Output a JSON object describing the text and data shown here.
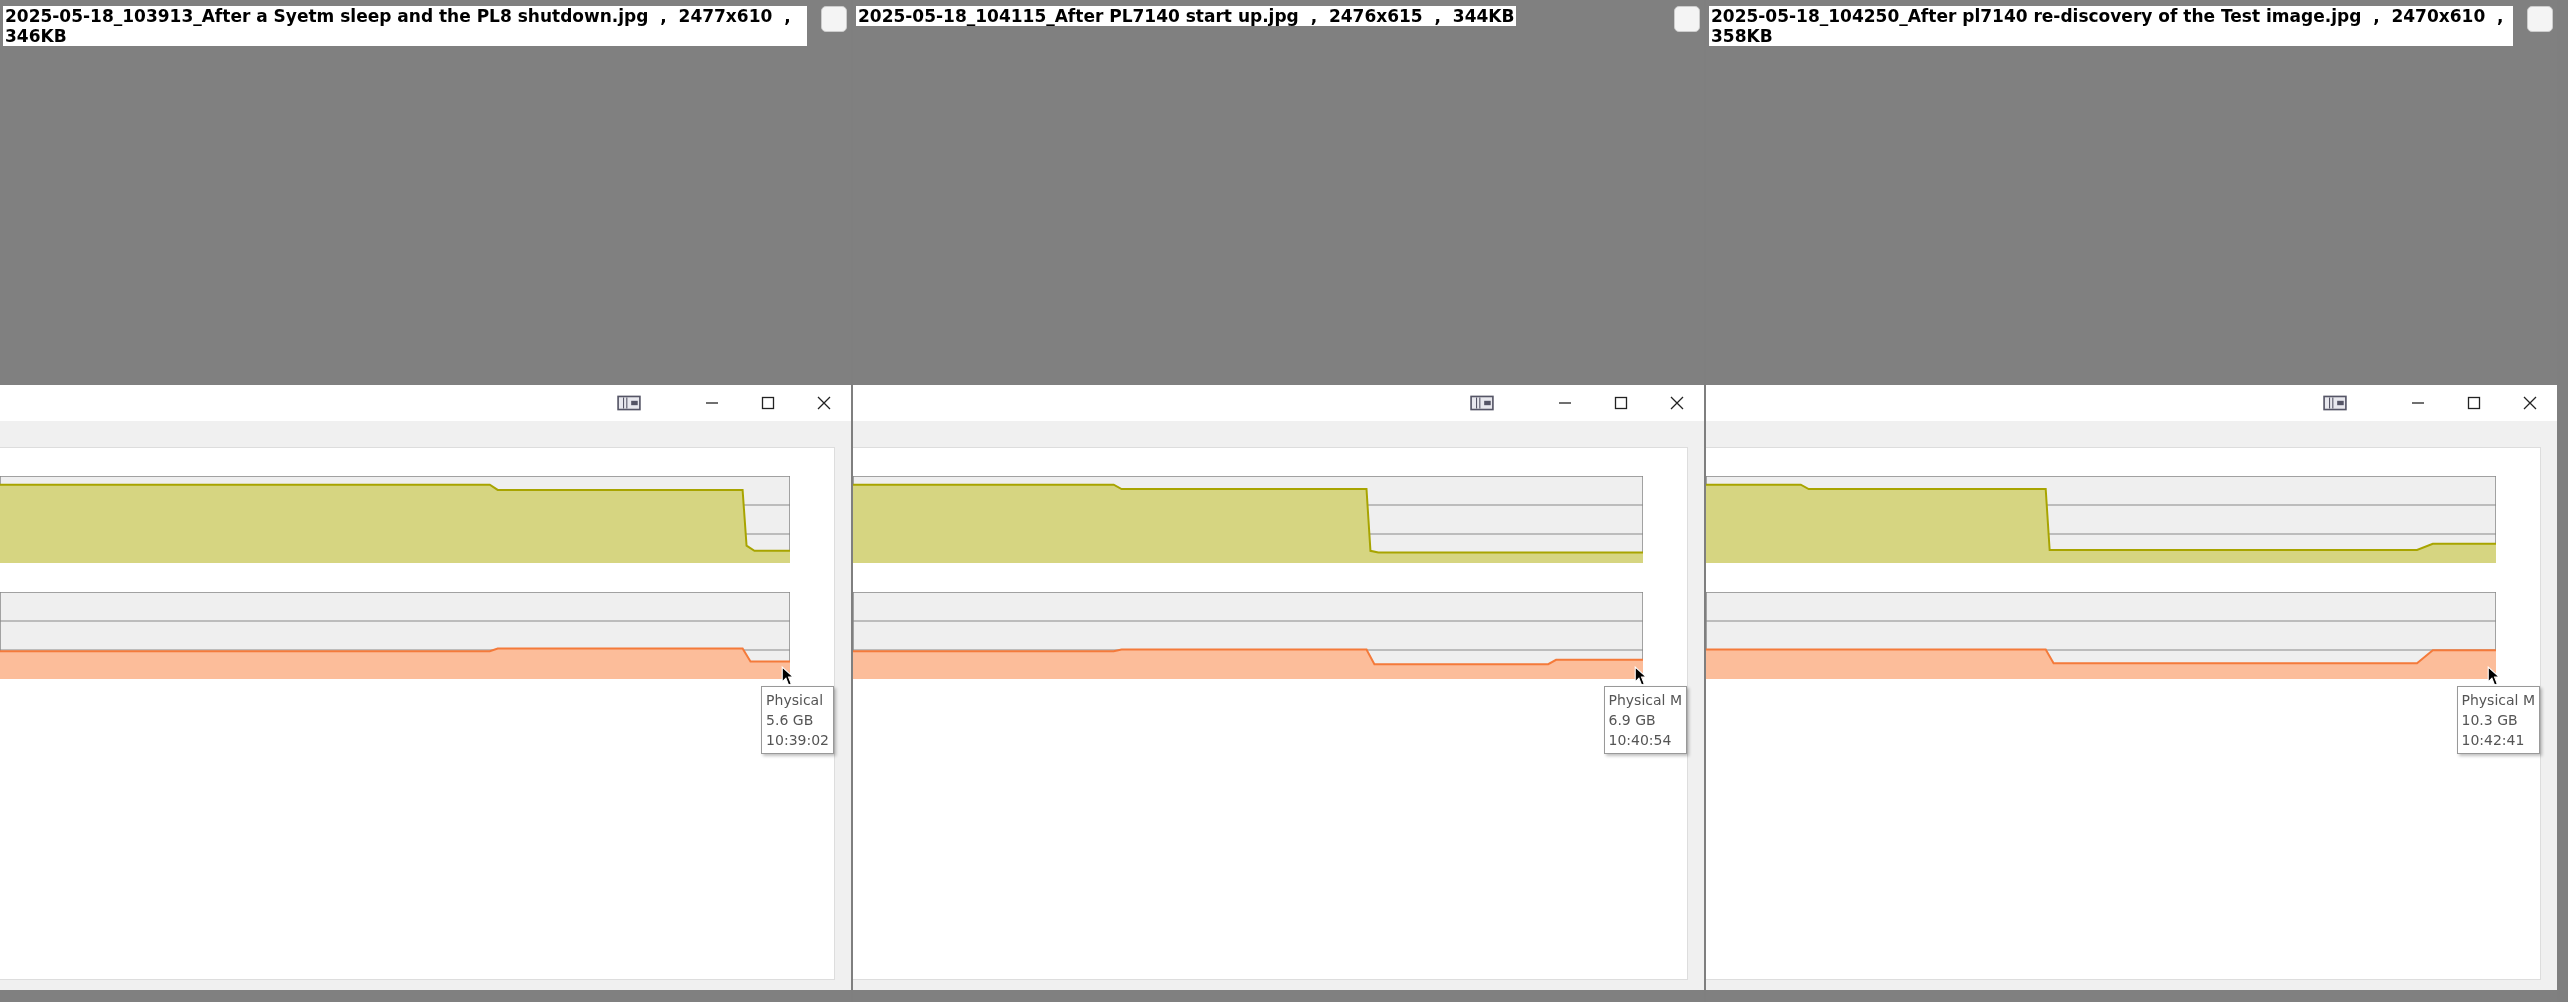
{
  "thumbnails": [
    {
      "caption": "2025-05-18_103913_After a Syetm sleep and the PL8 shutdown.jpg  ,  2477x610  ,  346KB",
      "checked": false,
      "tooltip": [
        "Physical",
        "5.6 GB",
        "10:39:02"
      ]
    },
    {
      "caption": "2025-05-18_104115_After PL7140 start up.jpg  ,  2476x615  ,  344KB",
      "checked": false,
      "tooltip": [
        "Physical M",
        "6.9 GB",
        "10:40:54"
      ]
    },
    {
      "caption": "2025-05-18_104250_After pl7140 re-discovery of the Test image.jpg  ,  2470x610  ,  358KB",
      "checked": false,
      "tooltip": [
        "Physical M",
        "10.3 GB",
        "10:42:41"
      ]
    }
  ]
}
